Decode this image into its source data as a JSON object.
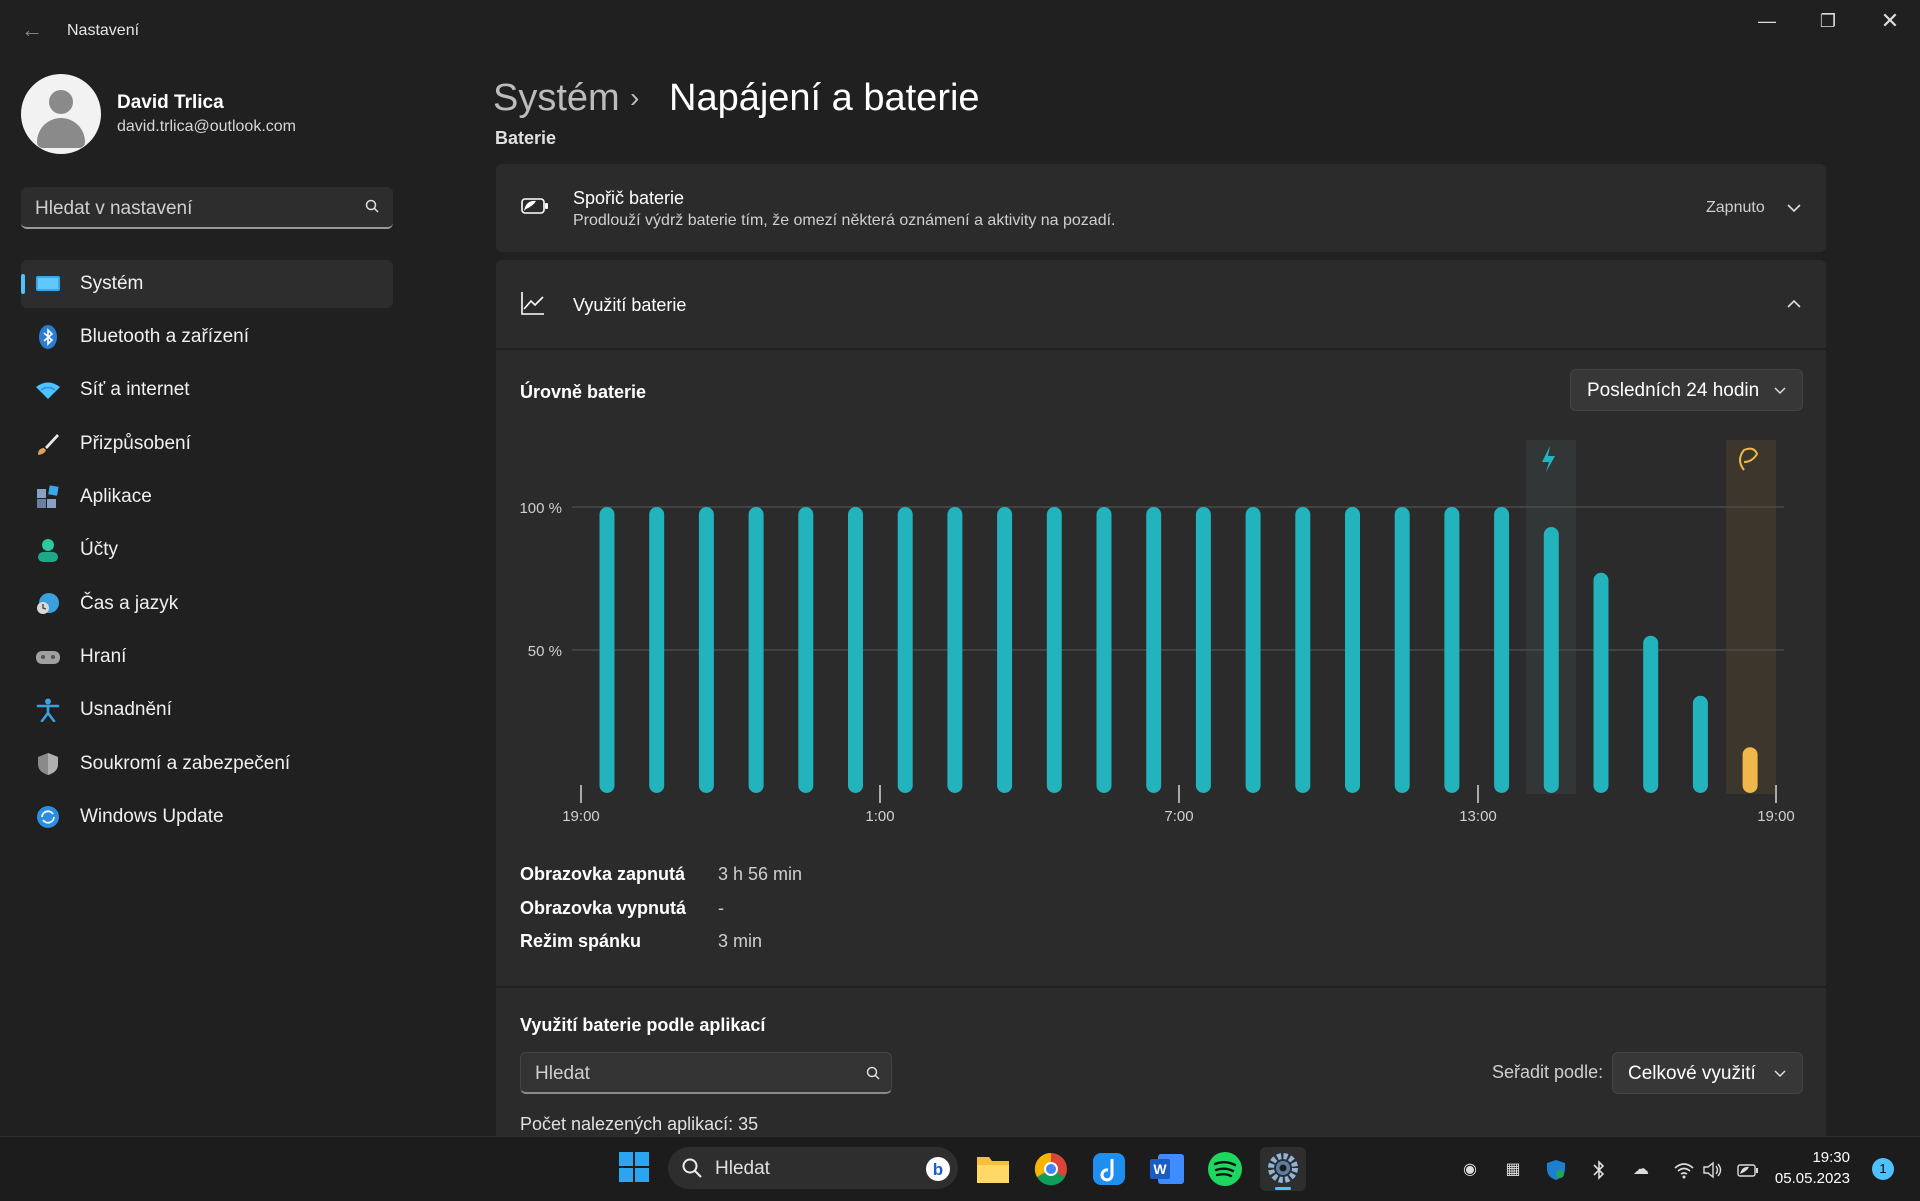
{
  "window": {
    "title": "Nastavení",
    "back_icon": "back-arrow-icon",
    "minimize_icon": "minimize-icon",
    "maximize_icon": "restore-icon",
    "close_icon": "close-icon"
  },
  "profile": {
    "name": "David Trlica",
    "email": "david.trlica@outlook.com"
  },
  "search": {
    "placeholder": "Hledat v nastavení"
  },
  "nav": {
    "items": [
      {
        "label": "Systém",
        "icon": "system-icon",
        "color": "#4cc2ff",
        "active": true
      },
      {
        "label": "Bluetooth a zařízení",
        "icon": "bluetooth-icon",
        "color": "#2b7cd3"
      },
      {
        "label": "Síť a internet",
        "icon": "wifi-icon",
        "color": "#4cc2ff"
      },
      {
        "label": "Přizpůsobení",
        "icon": "brush-icon",
        "color": "#e0a060"
      },
      {
        "label": "Aplikace",
        "icon": "apps-icon",
        "color": "#8aa0c0"
      },
      {
        "label": "Účty",
        "icon": "account-icon",
        "color": "#2dc7a0"
      },
      {
        "label": "Čas a jazyk",
        "icon": "globe-clock-icon",
        "color": "#3aa0e0"
      },
      {
        "label": "Hraní",
        "icon": "gamepad-icon",
        "color": "#a0a0a0"
      },
      {
        "label": "Usnadnění",
        "icon": "accessibility-icon",
        "color": "#3aa0e0"
      },
      {
        "label": "Soukromí a zabezpečení",
        "icon": "shield-icon",
        "color": "#8a8a8a"
      },
      {
        "label": "Windows Update",
        "icon": "update-icon",
        "color": "#2b8ee0"
      }
    ]
  },
  "header": {
    "parent": "Systém",
    "separator": "›",
    "page": "Napájení a baterie",
    "section_partial": "Baterie"
  },
  "battery_saver": {
    "title": "Spořič baterie",
    "subtitle": "Prodlouží výdrž baterie tím, že omezí některá oznámení a aktivity na pozadí.",
    "status": "Zapnuto",
    "icon": "battery-saver-icon"
  },
  "usage": {
    "title": "Využití baterie",
    "icon": "chart-line-icon",
    "levels_title": "Úrovně baterie",
    "range_select": "Posledních 24 hodin",
    "stats": [
      {
        "label": "Obrazovka zapnutá",
        "value": "3 h 56 min"
      },
      {
        "label": "Obrazovka vypnutá",
        "value": "-"
      },
      {
        "label": "Režim spánku",
        "value": "3 min"
      }
    ]
  },
  "apps": {
    "title": "Využití baterie podle aplikací",
    "search_placeholder": "Hledat",
    "sort_label": "Seřadit podle:",
    "sort_value": "Celkové využití",
    "count_text": "Počet nalezených aplikací: 35"
  },
  "chart_data": {
    "type": "bar",
    "x_tick_labels": [
      "19:00",
      "1:00",
      "7:00",
      "13:00",
      "19:00"
    ],
    "y_tick_labels": [
      "100 %",
      "50 %"
    ],
    "ylim": [
      0,
      100
    ],
    "bar_color": "#22b3bd",
    "highlight_color": "#f0b84a",
    "values": [
      100,
      100,
      100,
      100,
      100,
      100,
      100,
      100,
      100,
      100,
      100,
      100,
      100,
      100,
      100,
      100,
      100,
      100,
      100,
      93,
      77,
      55,
      34,
      16
    ],
    "charging_index": 19,
    "saver_index": 23
  },
  "taskbar": {
    "search_text": "Hledat",
    "apps": [
      "windows-start-icon",
      "file-explorer-icon",
      "chrome-icon",
      "music-app-icon",
      "word-icon",
      "spotify-icon",
      "settings-gear-icon"
    ],
    "time": "19:30",
    "date": "05.05.2023",
    "notifications": "1"
  }
}
